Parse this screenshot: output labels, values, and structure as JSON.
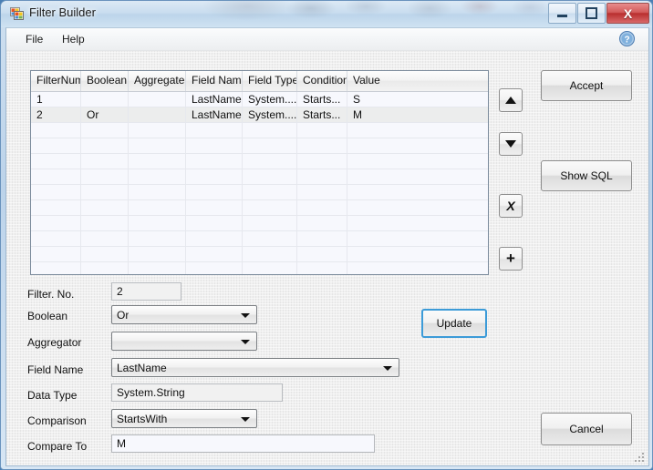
{
  "window": {
    "title": "Filter Builder",
    "icon": "form-icon",
    "controls": {
      "minimize": "minimize-icon",
      "maximize": "maximize-icon",
      "close": "X"
    }
  },
  "menubar": {
    "items": [
      {
        "label": "File"
      },
      {
        "label": "Help"
      }
    ],
    "help_icon": "help-circle-icon"
  },
  "grid": {
    "columns": [
      "FilterNum",
      "Boolean",
      "Aggregate",
      "Field Name",
      "Field Type",
      "Condition",
      "Value"
    ],
    "rows": [
      {
        "filter_num": "1",
        "boolean": "",
        "aggregate": "",
        "field_name": "LastName",
        "field_type": "System....",
        "condition": "Starts...",
        "value": "S",
        "selected": false
      },
      {
        "filter_num": "2",
        "boolean": "Or",
        "aggregate": "",
        "field_name": "LastName",
        "field_type": "System....",
        "condition": "Starts...",
        "value": "M",
        "selected": true
      }
    ],
    "empty_row_count": 10
  },
  "row_tools": {
    "move_up": "▲",
    "move_down": "▼",
    "delete": "X",
    "add": "+"
  },
  "actions": {
    "accept": "Accept",
    "show_sql": "Show SQL",
    "update": "Update",
    "cancel": "Cancel"
  },
  "form": {
    "filter_no": {
      "label": "Filter. No.",
      "value": "2"
    },
    "boolean": {
      "label": "Boolean",
      "value": "Or"
    },
    "aggregator": {
      "label": "Aggregator",
      "value": ""
    },
    "field_name": {
      "label": "Field Name",
      "value": "LastName"
    },
    "data_type": {
      "label": "Data Type",
      "value": "System.String"
    },
    "comparison": {
      "label": "Comparison",
      "value": "StartsWith"
    },
    "compare_to": {
      "label": "Compare To",
      "value": "M"
    }
  },
  "colors": {
    "accent": "#3c9bd8",
    "close": "#b92e2e",
    "grid_selection": "#eceded"
  }
}
